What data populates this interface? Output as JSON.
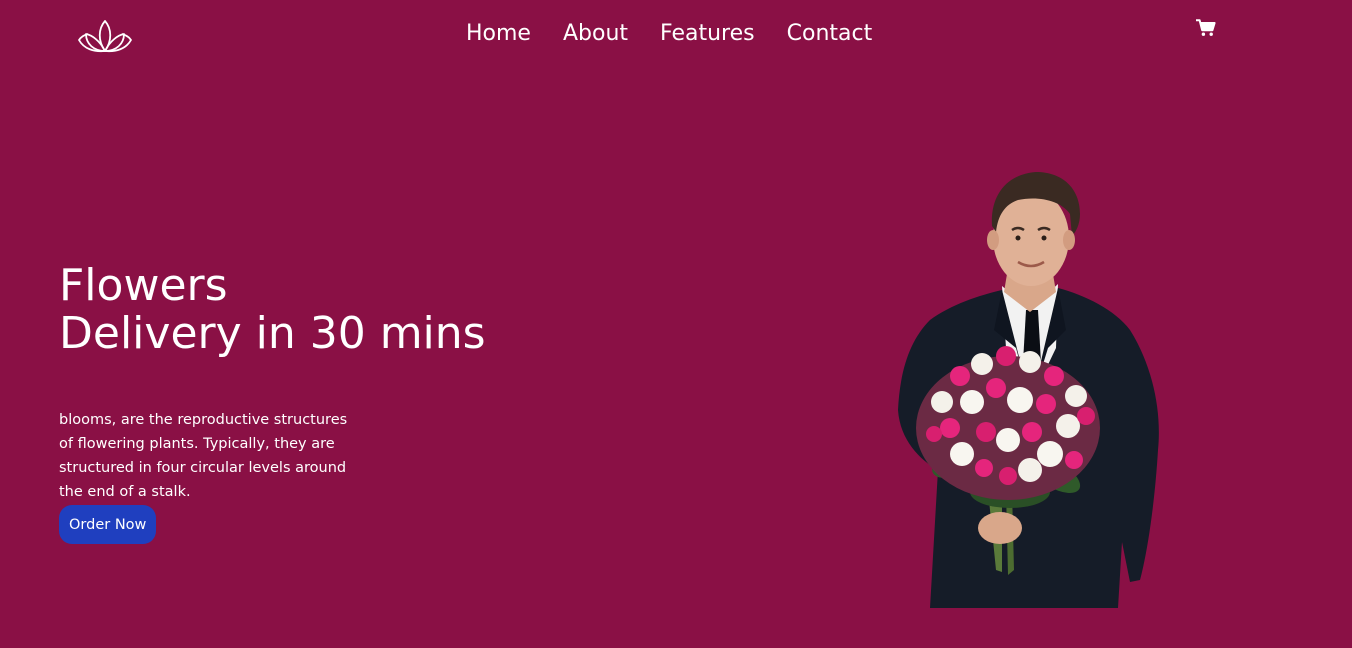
{
  "header": {
    "logo_icon": "lotus-icon",
    "nav": {
      "home": "Home",
      "about": "About",
      "features": "Features",
      "contact": "Contact"
    },
    "cart_icon": "cart-icon"
  },
  "hero": {
    "title_line1": "Flowers",
    "title_line2": "Delivery in 30 mins",
    "description": "blooms, are the reproductive structures of flowering plants. Typically, they are structured in four circular levels around the end of a stalk.",
    "cta_label": "Order Now",
    "image_icon": "man-holding-bouquet-illustration"
  },
  "colors": {
    "background": "#8a1045",
    "button": "#1f3fbf",
    "text": "#ffffff"
  }
}
